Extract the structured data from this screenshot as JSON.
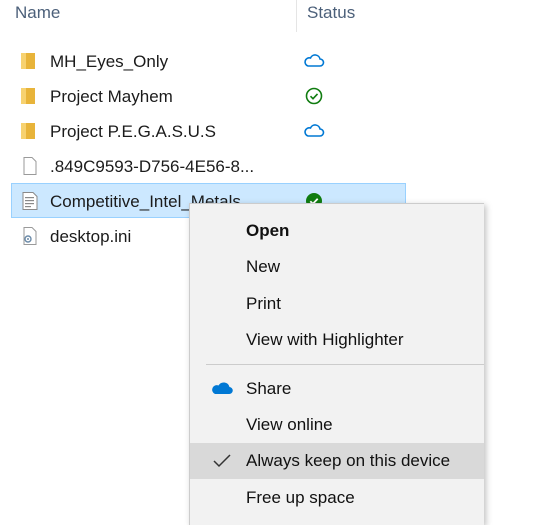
{
  "header": {
    "name": "Name",
    "status": "Status"
  },
  "files": [
    {
      "name": "MH_Eyes_Only",
      "type": "folder",
      "status": "cloud"
    },
    {
      "name": "Project Mayhem",
      "type": "folder",
      "status": "synced"
    },
    {
      "name": "Project P.E.G.A.S.U.S",
      "type": "folder",
      "status": "cloud"
    },
    {
      "name": ".849C9593-D756-4E56-8...",
      "type": "file",
      "status": ""
    },
    {
      "name": "Competitive_Intel_Metals",
      "type": "document",
      "status": "always-available"
    },
    {
      "name": "desktop.ini",
      "type": "settings-file",
      "status": ""
    }
  ],
  "context_menu": {
    "open": "Open",
    "new": "New",
    "print": "Print",
    "view_highlighter": "View with Highlighter",
    "share": "Share",
    "view_online": "View online",
    "always_keep": "Always keep on this device",
    "free_up": "Free up space"
  },
  "colors": {
    "selection_bg": "#cce8ff",
    "onedrive_blue": "#0078d4",
    "sync_green": "#107c10",
    "folder_yellow": "#e8b43a"
  }
}
